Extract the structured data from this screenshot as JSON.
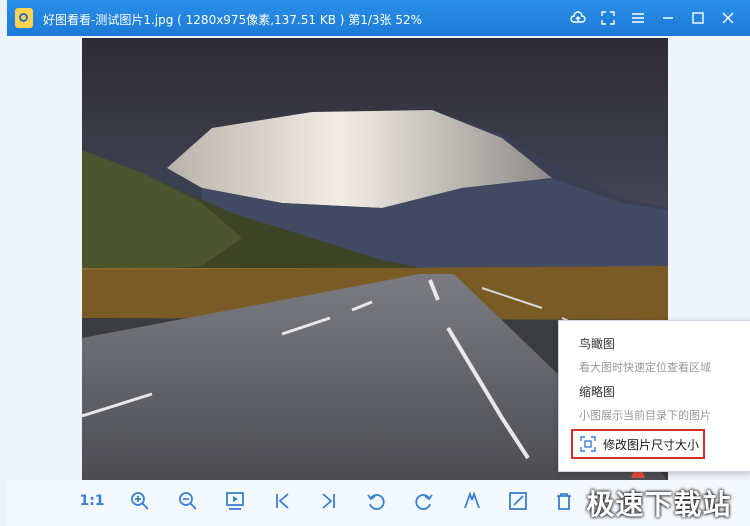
{
  "window": {
    "title": "好图看看-测试图片1.jpg ( 1280x975像素,137.51 KB )   第1/3张   52%"
  },
  "icons": {
    "app": "app-logo-icon",
    "upload": "upload-cloud-icon",
    "fullscreen": "fullscreen-icon",
    "menu": "menu-icon",
    "minimize": "minimize-icon",
    "maximize": "maximize-icon",
    "close": "close-icon"
  },
  "context_menu": {
    "item1_label": "鸟瞰图",
    "item1_desc": "看大图时快速定位查看区域",
    "item2_label": "缩略图",
    "item2_desc": "小图展示当前目录下的图片",
    "item3_label": "修改图片尺寸大小"
  },
  "toolbar": {
    "actual_size_label": "1:1"
  },
  "watermark": {
    "text": "极速下载站"
  },
  "colors": {
    "titlebar": "#1c7ad6",
    "accent": "#3a7fd0",
    "highlight_border": "#d2302c"
  }
}
